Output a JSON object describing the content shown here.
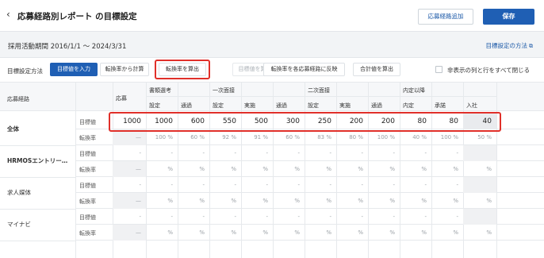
{
  "header": {
    "back_icon": "‹",
    "title": "応募経路別レポート の目標設定",
    "add_route_label": "応募経路追加",
    "save_label": "保存"
  },
  "period": {
    "text": "採用活動期間  2016/1/1 〜 2024/3/31",
    "method_link": "目標設定の方法",
    "method_icon": "external-link-icon"
  },
  "toolbar": {
    "label": "目標設定方法",
    "buttons": [
      "目標値を入力",
      "転換率から計算",
      "転換率を算出",
      "目標値を算出",
      "転換率を各応募経路に反映",
      "合計値を算出"
    ],
    "hide_label": "非表示の列と行をすべて閉じる"
  },
  "table": {
    "route_header": "応募経路",
    "apply_header": "応募",
    "groups": [
      "書類選考",
      "一次面接",
      "二次面接",
      "内定以降"
    ],
    "subs": [
      "設定",
      "通過",
      "設定",
      "実施",
      "通過",
      "設定",
      "実施",
      "通過",
      "内定",
      "承諾",
      "入社"
    ],
    "row_labels": {
      "target": "目標値",
      "rate": "転換率"
    },
    "rows": [
      {
        "name": "全体",
        "target": [
          "1000",
          "1000",
          "600",
          "550",
          "500",
          "300",
          "250",
          "200",
          "200",
          "80",
          "80",
          "40"
        ],
        "rate": [
          "—",
          "100 %",
          "60 %",
          "92 %",
          "91 %",
          "60 %",
          "83 %",
          "80 %",
          "100 %",
          "40 %",
          "100 %",
          "50 %"
        ]
      },
      {
        "name": "HRMOSエントリー…",
        "target": [
          "-",
          "-",
          "-",
          "-",
          "-",
          "-",
          "-",
          "-",
          "-",
          "-",
          "-",
          ""
        ],
        "rate": [
          "—",
          "%",
          "%",
          "%",
          "%",
          "%",
          "%",
          "%",
          "%",
          "%",
          "%",
          "%"
        ]
      },
      {
        "name": "求人媒体",
        "target": [
          "-",
          "-",
          "-",
          "-",
          "-",
          "-",
          "-",
          "-",
          "-",
          "-",
          "-",
          ""
        ],
        "rate": [
          "—",
          "%",
          "%",
          "%",
          "%",
          "%",
          "%",
          "%",
          "%",
          "%",
          "%",
          "%"
        ]
      },
      {
        "name": "マイナビ",
        "target": [
          "-",
          "-",
          "-",
          "-",
          "-",
          "-",
          "-",
          "-",
          "-",
          "-",
          "-",
          ""
        ],
        "rate": [
          "—",
          "%",
          "%",
          "%",
          "%",
          "%",
          "%",
          "%",
          "%",
          "%",
          "%",
          "%"
        ]
      }
    ]
  },
  "colors": {
    "accent": "#1f5fb4",
    "highlight_border": "#e0302a",
    "header_bg": "#f6f7f9",
    "gray_cell": "#f0f1f3"
  }
}
